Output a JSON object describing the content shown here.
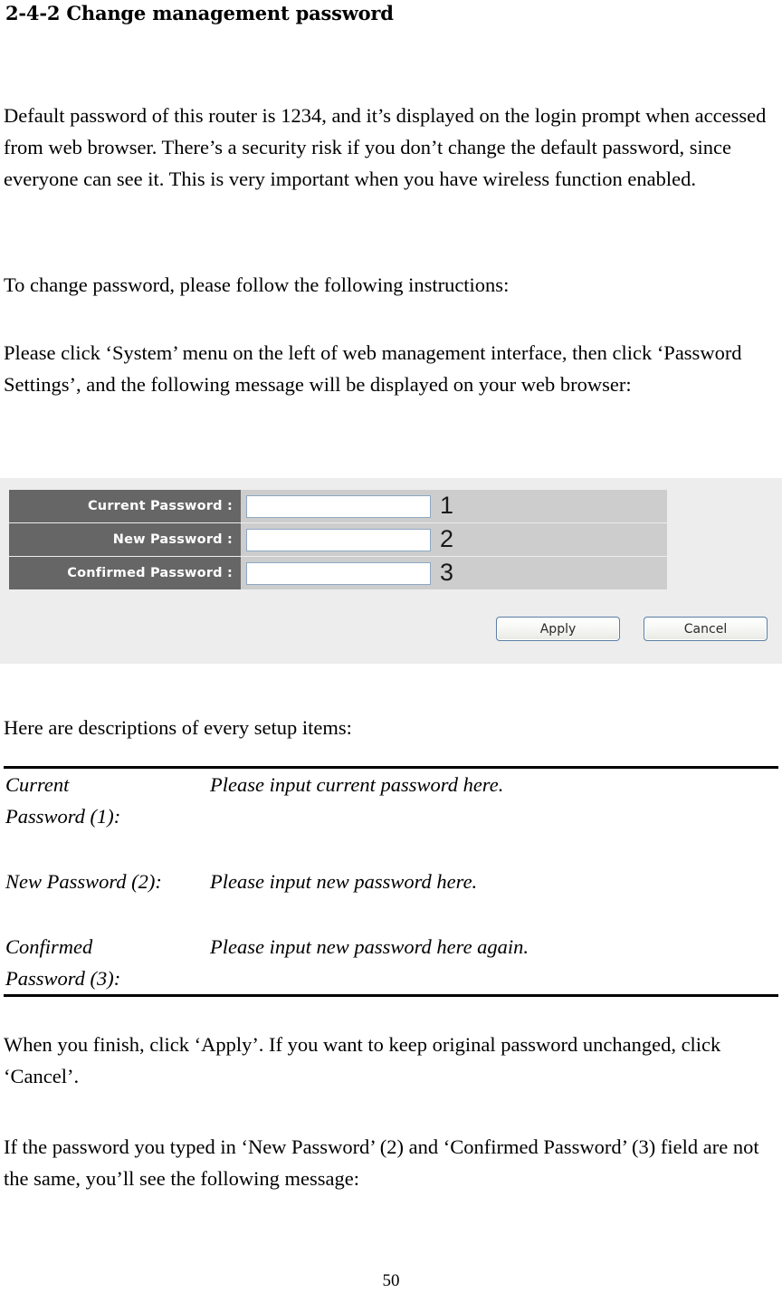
{
  "document": {
    "heading": "2-4-2 Change management password",
    "page_number": "50",
    "paragraphs": {
      "default_password": "Default password of this router is 1234, and it’s displayed on the login prompt when accessed from web browser. There’s a security risk if you don’t change the default password, since everyone can see it. This is very important when you have wireless function enabled.",
      "to_change": "To change password, please follow the following instructions:",
      "please_click": "Please click ‘System’ menu on the left of web management interface, then click ‘Password Settings’, and the following message will be displayed on your web browser:",
      "descriptions_intro": "Here are descriptions of every setup items:",
      "when_you_finish": "When you finish, click ‘Apply’. If you want to keep original password unchanged, click ‘Cancel’.",
      "if_mismatch": "If the password you typed in ‘New Password’ (2) and ‘Confirmed Password’ (3) field are not the same, you’ll see the following message:"
    }
  },
  "embedded_ui": {
    "colors": {
      "panel_background": "#ededed",
      "label_cell": "#666666",
      "value_cell": "#cdcdcd",
      "input_border": "#8ca8c4",
      "button_border": "#5b7fa6",
      "label_text": "#ffffff"
    },
    "fields": [
      {
        "label": "Current Password :",
        "value": "",
        "placeholder": "",
        "marker": "1"
      },
      {
        "label": "New Password :",
        "value": "",
        "placeholder": "",
        "marker": "2"
      },
      {
        "label": "Confirmed Password :",
        "value": "",
        "placeholder": "",
        "marker": "3"
      }
    ],
    "buttons": {
      "apply": "Apply",
      "cancel": "Cancel"
    }
  },
  "definitions": {
    "rows": [
      {
        "term_line1": "Current",
        "term_line2": "Password (1):",
        "description": "Please input current password here."
      },
      {
        "term_line1": "New Password (2):",
        "term_line2": "",
        "description": "Please input new password here."
      },
      {
        "term_line1": "Confirmed",
        "term_line2": "Password (3):",
        "description": "Please input new password here again."
      }
    ]
  }
}
